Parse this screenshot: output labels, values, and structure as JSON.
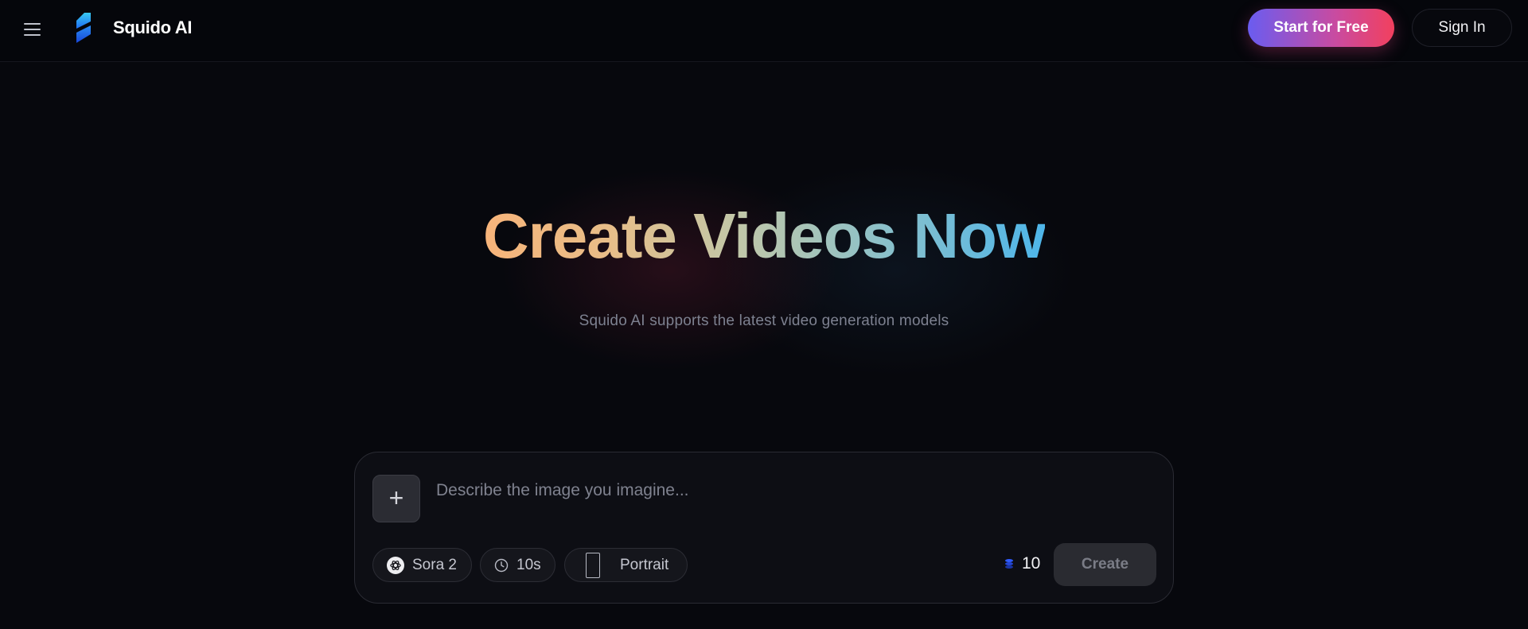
{
  "header": {
    "brand": "Squido AI",
    "start_label": "Start for Free",
    "signin_label": "Sign In"
  },
  "hero": {
    "title": "Create Videos Now",
    "subtitle": "Squido AI supports the latest video generation models"
  },
  "composer": {
    "placeholder": "Describe the image you imagine...",
    "model": "Sora 2",
    "duration": "10s",
    "orientation": "Portrait",
    "credits": "10",
    "create_label": "Create"
  },
  "colors": {
    "accent_start": "#6a5cf0",
    "accent_end": "#f2405e",
    "title_gradient_start": "#f7b47a",
    "title_gradient_end": "#4eb6ea",
    "background": "#07080d"
  },
  "icons": {
    "menu": "hamburger-icon",
    "logo": "squido-logo",
    "add": "plus-icon",
    "model": "openai-icon",
    "duration": "clock-icon",
    "orientation": "portrait-frame-icon",
    "credits": "coin-stack-icon"
  }
}
